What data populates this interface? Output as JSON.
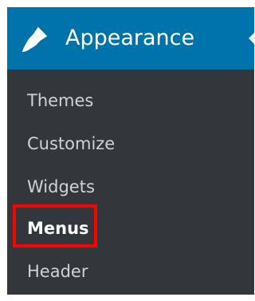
{
  "menu": {
    "title": "Appearance",
    "icon": "paintbrush-icon",
    "colors": {
      "header_bg": "#0073aa",
      "submenu_bg": "#32373c",
      "item_text": "#d2d2d2",
      "current_text": "#ffffff",
      "highlight": "#ff0000"
    },
    "items": [
      {
        "label": "Themes",
        "current": false
      },
      {
        "label": "Customize",
        "current": false
      },
      {
        "label": "Widgets",
        "current": false
      },
      {
        "label": "Menus",
        "current": true
      },
      {
        "label": "Header",
        "current": false
      }
    ]
  }
}
